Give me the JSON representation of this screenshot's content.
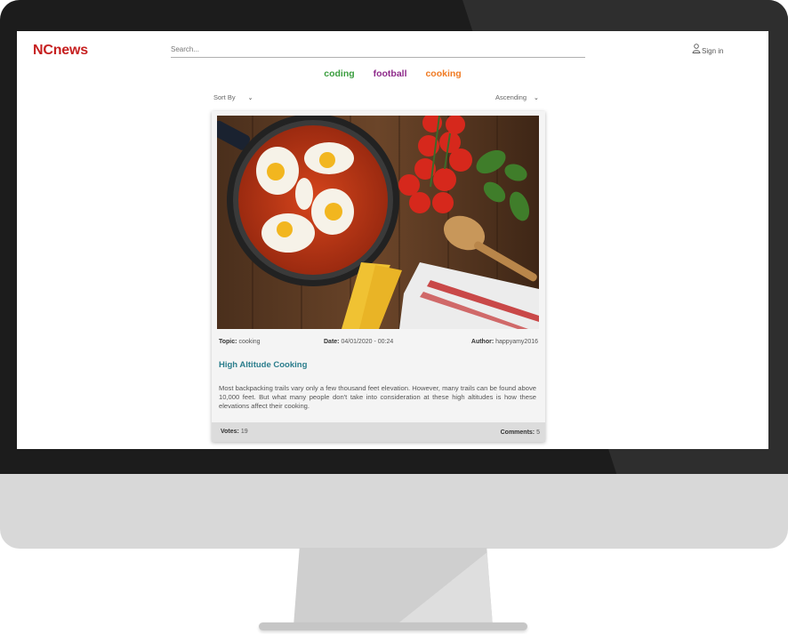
{
  "app": {
    "logo": "NCnews",
    "search_placeholder": "Search...",
    "signin_label": "Sign in"
  },
  "topics": [
    {
      "label": "coding",
      "color": "#3a9d3e"
    },
    {
      "label": "football",
      "color": "#8e2a8a"
    },
    {
      "label": "cooking",
      "color": "#f07a22"
    }
  ],
  "sort": {
    "sort_by_label": "Sort By",
    "order_label": "Ascending"
  },
  "article": {
    "topic_label": "Topic:",
    "topic": "cooking",
    "date_label": "Date:",
    "date": "04/01/2020 - 00:24",
    "author_label": "Author:",
    "author": "happyamy2016",
    "title": "High Altitude Cooking",
    "body": "Most backpacking trails vary only a few thousand feet elevation. However, many trails can be found above 10,000 feet. But what many people don't take into consideration at these high altitudes is how these elevations affect their cooking.",
    "votes_label": "Votes:",
    "votes": "19",
    "comments_label": "Comments:",
    "comments": "5"
  },
  "colors": {
    "logo": "#c62020",
    "title": "#2a7d8c"
  }
}
